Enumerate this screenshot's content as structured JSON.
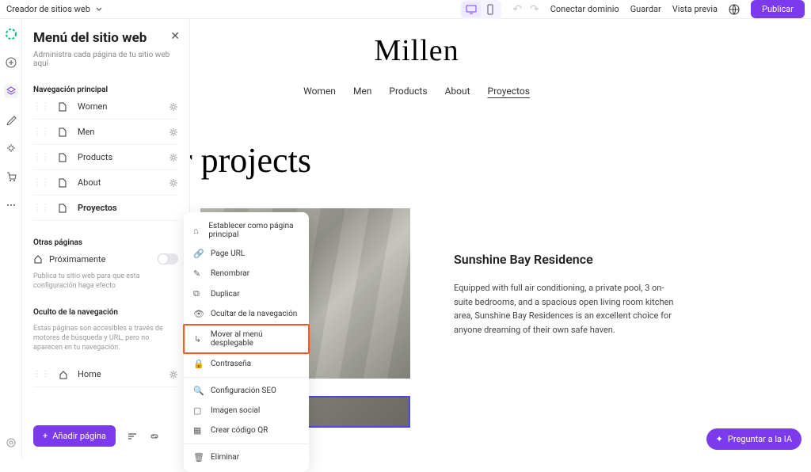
{
  "topbar": {
    "breadcrumb": "Creador de sitios web",
    "connect_domain": "Conectar dominio",
    "save": "Guardar",
    "preview": "Vista previa",
    "publish": "Publicar"
  },
  "panel": {
    "title": "Menú del sitio web",
    "subtitle": "Administra cada página de tu sitio web aquí",
    "nav_section": "Navegación principal",
    "pages": [
      {
        "label": "Women"
      },
      {
        "label": "Men"
      },
      {
        "label": "Products"
      },
      {
        "label": "About"
      },
      {
        "label": "Proyectos",
        "bold": true
      }
    ],
    "other_section": "Otras páginas",
    "coming_soon": "Próximamente",
    "publish_hint": "Publica tu sitio web para que esta configuración haga efecto",
    "hidden_section": "Oculto de la navegación",
    "hidden_hint": "Estas páginas son accesibles a través de motores de búsqueda y URL, pero no aparecen en tu navegación.",
    "home_label": "Home",
    "add_page": "Añadir página"
  },
  "ctx": {
    "set_main": "Establecer como página principal",
    "page_url": "Page URL",
    "rename": "Renombrar",
    "duplicate": "Duplicar",
    "hide": "Ocultar de la navegación",
    "move_dropdown": "Mover al menú desplegable",
    "password": "Contraseña",
    "seo": "Configuración SEO",
    "social_image": "Imagen social",
    "qr": "Crear código QR",
    "delete": "Eliminar"
  },
  "site": {
    "title": "Millen",
    "nav": [
      "Women",
      "Men",
      "Products",
      "About",
      "Proyectos"
    ],
    "heading": "r projects",
    "proj_title": "Sunshine Bay Residence",
    "proj_desc": "Equipped with full air conditioning, a private pool, 3 on-suite bedrooms, and a spacious open living room kitchen area, Sunshine Bay Residences is an excellent choice for anyone dreaming of their own safe haven."
  },
  "ai_button": "Preguntar a la IA"
}
